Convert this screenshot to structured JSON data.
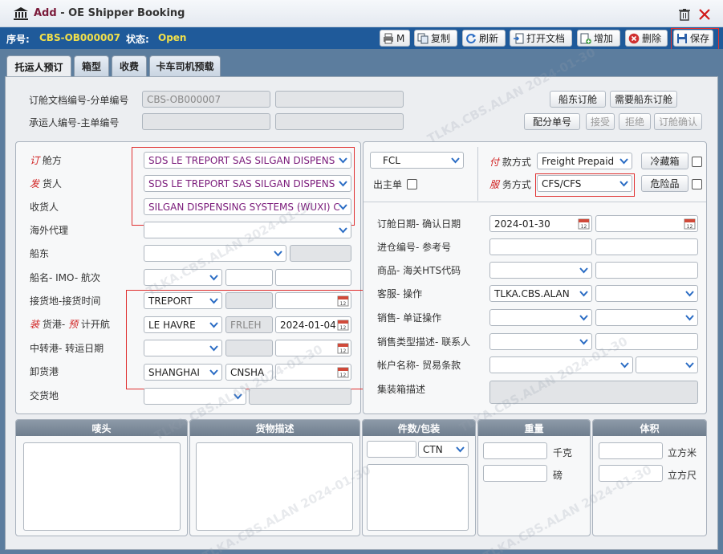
{
  "window": {
    "title_add": "Add",
    "title_rest": " - OE Shipper Booking"
  },
  "toolbar": {
    "seq_label": "序号:",
    "seq_value": "CBS-OB000007",
    "status_label": "状态:",
    "status_value": "Open",
    "buttons": {
      "print": "M",
      "copy": "复制",
      "refresh": "刷新",
      "open_doc": "打开文档",
      "add": "增加",
      "delete": "删除",
      "save": "保存"
    }
  },
  "tabs": [
    "托运人预订",
    "箱型",
    "收费",
    "卡车司机预载"
  ],
  "header": {
    "booking_doc_label": "订舱文档编号-分单编号",
    "booking_doc_value": "CBS-OB000007",
    "carrier_no_label": "承运人编号-主单编号",
    "btn_carrier_booking": "船东订舱",
    "btn_need_carrier": "需要船东订舱",
    "btn_split": "配分单号",
    "btn_accept": "接受",
    "btn_reject": "拒绝",
    "btn_confirm": "订舱确认"
  },
  "left": {
    "booker": {
      "label_red": "订",
      "label_rest": " 舱方",
      "value": "SDS LE TREPORT SAS SILGAN DISPENS"
    },
    "shipper": {
      "label_red": "发",
      "label_rest": " 货人",
      "value": "SDS LE TREPORT SAS SILGAN DISPENS"
    },
    "consignee": {
      "label": "收货人",
      "value": "SILGAN DISPENSING SYSTEMS (WUXI) C"
    },
    "overseas_agent": {
      "label": "海外代理"
    },
    "carrier": {
      "label": "船东"
    },
    "vessel": {
      "label": "船名- IMO- 航次"
    },
    "receipt": {
      "label": "接货地-接货时间",
      "value": "TREPORT"
    },
    "pol": {
      "label_red1": "装",
      "label_mid": " 货港- ",
      "label_red2": "预",
      "label_rest": " 计开航",
      "value": "LE HAVRE",
      "code": "FRLEH",
      "date": "2024-01-04"
    },
    "transit": {
      "label": "中转港- 转运日期"
    },
    "pod": {
      "label": "卸货港",
      "value": "SHANGHAI",
      "code": "CNSHA"
    },
    "delivery": {
      "label": "交货地"
    }
  },
  "middle": {
    "load_type": "FCL",
    "master_label": "出主单"
  },
  "right": {
    "payment": {
      "label_red": "付",
      "label_rest": " 款方式",
      "value": "Freight Prepaid"
    },
    "service": {
      "label_red": "服",
      "label_rest": " 务方式",
      "value": "CFS/CFS"
    },
    "btn_reefer": "冷藏箱",
    "btn_dg": "危险品",
    "booking_date": {
      "label": "订舱日期- 确认日期",
      "value": "2024-01-30"
    },
    "warehouse_no": {
      "label": "进仓编号- 参考号"
    },
    "commodity": {
      "label": "商品- 海关HTS代码"
    },
    "cs": {
      "label": "客服- 操作",
      "value": "TLKA.CBS.ALAN"
    },
    "sales": {
      "label": "销售- 单证操作"
    },
    "sales_type": {
      "label": "销售类型描述- 联系人"
    },
    "account": {
      "label": "帐户名称- 贸易条款"
    },
    "container_desc": {
      "label": "集装箱描述"
    }
  },
  "bottom": {
    "marks": "唛头",
    "goods": "货物描述",
    "pieces": "件数/包装",
    "unit": "CTN",
    "weight": "重量",
    "kg": "千克",
    "lb": "磅",
    "volume": "体积",
    "cbm": "立方米",
    "cft": "立方尺"
  },
  "watermark": [
    "TLKA.CBS.ALAN 2024-01-30"
  ]
}
